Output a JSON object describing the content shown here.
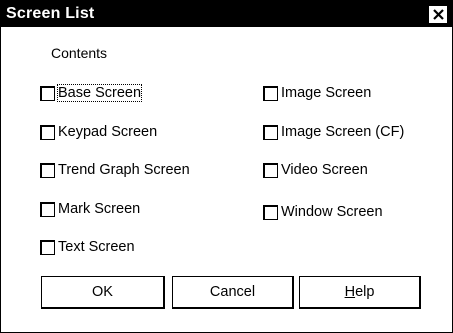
{
  "dialog": {
    "title": "Screen List",
    "close_icon": "close-icon"
  },
  "contents_label": "Contents",
  "options_left": [
    {
      "label": "Base Screen",
      "checked": false,
      "focused": true
    },
    {
      "label": "Keypad Screen",
      "checked": false
    },
    {
      "label": "Trend Graph Screen",
      "checked": false
    },
    {
      "label": "Mark Screen",
      "checked": false
    },
    {
      "label": "Text Screen",
      "checked": false
    }
  ],
  "options_right": [
    {
      "label": "Image Screen",
      "checked": false
    },
    {
      "label": "Image Screen (CF)",
      "checked": false
    },
    {
      "label": "Video Screen",
      "checked": false
    },
    {
      "label": "Window Screen",
      "checked": false
    }
  ],
  "buttons": {
    "ok": "OK",
    "cancel": "Cancel",
    "help": "Help"
  },
  "colors": {
    "titlebar": "#000000",
    "background": "#ffffff"
  }
}
